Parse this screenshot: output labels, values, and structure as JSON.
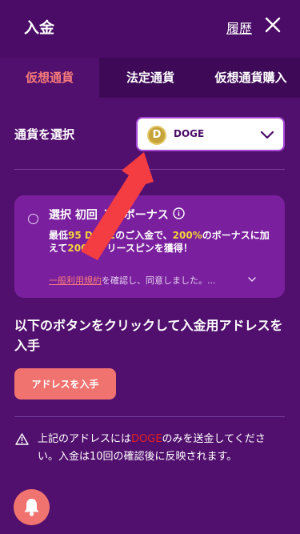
{
  "header": {
    "title": "入金",
    "history_label": "履歴"
  },
  "tabs": [
    {
      "label": "仮想通貨",
      "active": true
    },
    {
      "label": "法定通貨",
      "active": false
    },
    {
      "label": "仮想通貨購入",
      "active": false
    }
  ],
  "currency": {
    "label": "通貨を選択",
    "selected": "DOGE",
    "coin_letter": "D"
  },
  "bonus": {
    "title": "選択 初回 入金ボーナス",
    "desc_prefix": "最低",
    "min_amount": "95 DOGE",
    "desc_mid": "のご入金で、",
    "percent": "200%",
    "desc_mid2": "のボーナスに加えて",
    "free_spins": "200",
    "desc_suffix": "のフリースピンを獲得！",
    "terms_link": "一般利用規約",
    "terms_rest": "を確認し、同意しました。..."
  },
  "instruction": "以下のボタンをクリックして入金用アドレスを入手",
  "get_address_button": "アドレスを入手",
  "notice": {
    "prefix": "上記のアドレスには",
    "currency": "DOGE",
    "suffix": "のみを送金してください。入金は10回の確認後に反映されます。"
  },
  "colors": {
    "background": "#52106e",
    "accent": "#f0736f",
    "highlight": "#f2d43a",
    "warning_red": "#e02020"
  }
}
